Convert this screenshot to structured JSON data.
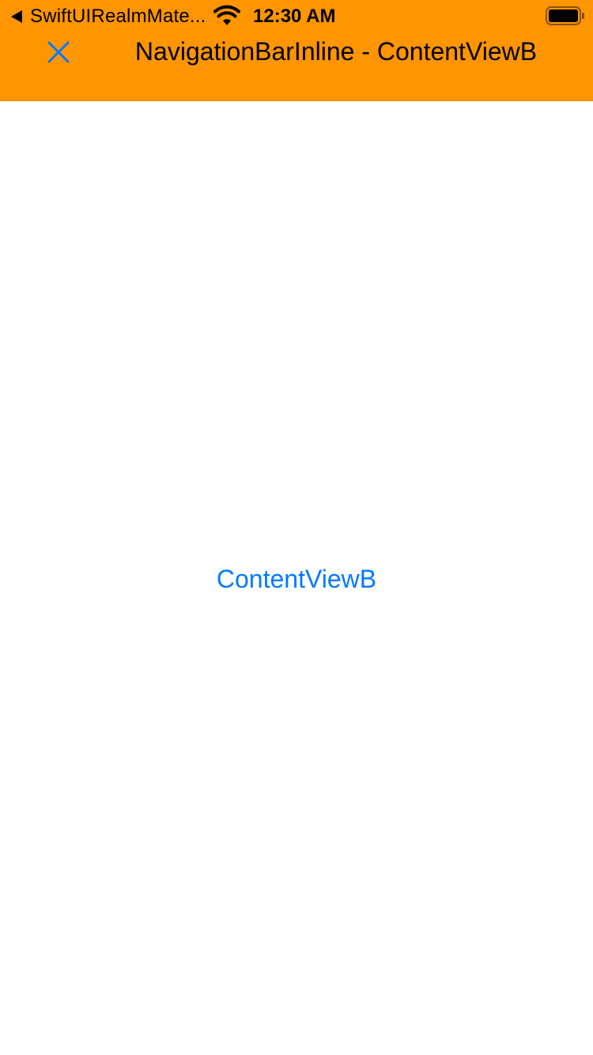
{
  "status_bar": {
    "back_app_label": "SwiftUIRealmMate...",
    "time": "12:30 AM",
    "icons": {
      "back": "back-caret-icon",
      "wifi": "wifi-icon",
      "battery": "battery-icon"
    }
  },
  "nav_bar": {
    "title": "NavigationBarInline - ContentViewB",
    "leading_icon": "close-icon",
    "background_color": "#FF9500",
    "tint_color": "#007AFF"
  },
  "main": {
    "link_text": "ContentViewB",
    "link_color": "#007AFF"
  }
}
